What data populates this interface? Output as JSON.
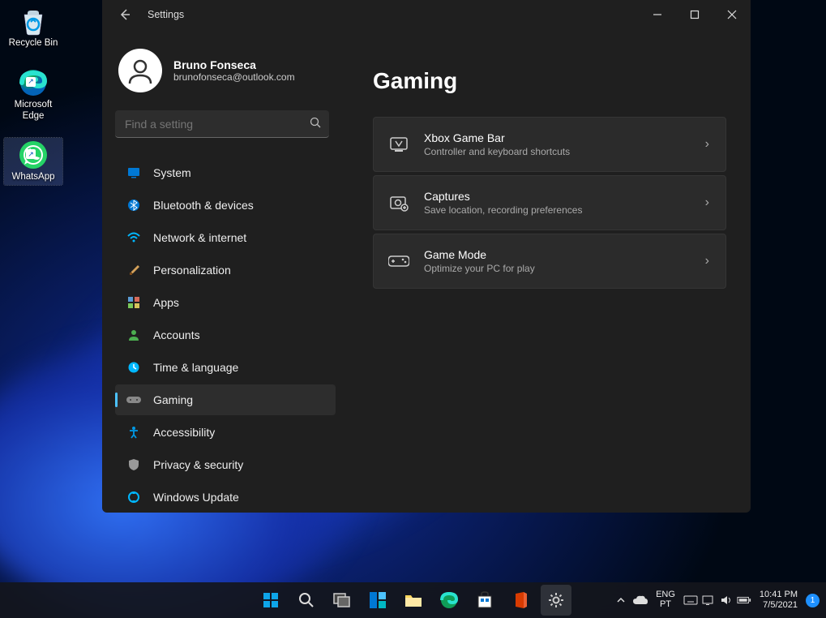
{
  "desktop": {
    "icons": [
      {
        "label": "Recycle Bin"
      },
      {
        "label": "Microsoft Edge"
      },
      {
        "label": "WhatsApp"
      }
    ]
  },
  "window": {
    "app_title": "Settings",
    "account": {
      "name": "Bruno Fonseca",
      "email": "brunofonseca@outlook.com"
    },
    "search": {
      "placeholder": "Find a setting"
    },
    "nav": [
      {
        "label": "System"
      },
      {
        "label": "Bluetooth & devices"
      },
      {
        "label": "Network & internet"
      },
      {
        "label": "Personalization"
      },
      {
        "label": "Apps"
      },
      {
        "label": "Accounts"
      },
      {
        "label": "Time & language"
      },
      {
        "label": "Gaming"
      },
      {
        "label": "Accessibility"
      },
      {
        "label": "Privacy & security"
      },
      {
        "label": "Windows Update"
      }
    ],
    "page": {
      "title": "Gaming",
      "cards": [
        {
          "title": "Xbox Game Bar",
          "sub": "Controller and keyboard shortcuts"
        },
        {
          "title": "Captures",
          "sub": "Save location, recording preferences"
        },
        {
          "title": "Game Mode",
          "sub": "Optimize your PC for play"
        }
      ]
    }
  },
  "taskbar": {
    "lang": {
      "line1": "ENG",
      "line2": "PT"
    },
    "clock": {
      "time": "10:41 PM",
      "date": "7/5/2021"
    },
    "notifications": "1"
  }
}
